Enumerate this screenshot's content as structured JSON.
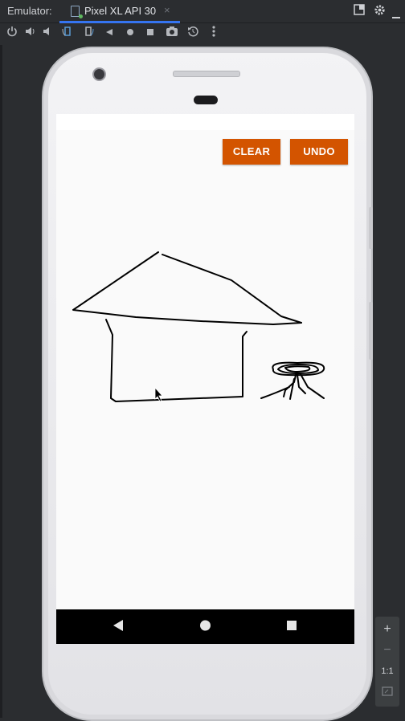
{
  "window": {
    "title_label": "Emulator:",
    "tab_label": "Pixel XL API 30",
    "tab_close": "×"
  },
  "toolbar_icons": [
    "power-icon",
    "volume-up-icon",
    "volume-down-icon",
    "rotate-left-icon",
    "rotate-right-icon",
    "back-icon",
    "home-icon",
    "overview-icon",
    "camera-icon",
    "snapshot-icon",
    "more-icon"
  ],
  "app": {
    "clear_label": "CLEAR",
    "undo_label": "UNDO",
    "accent": "#d35400"
  },
  "zoom": {
    "plus": "+",
    "minus": "−",
    "ratio": "1:1"
  },
  "navbar": {
    "back": "◀",
    "home": "●",
    "recents": "■"
  }
}
